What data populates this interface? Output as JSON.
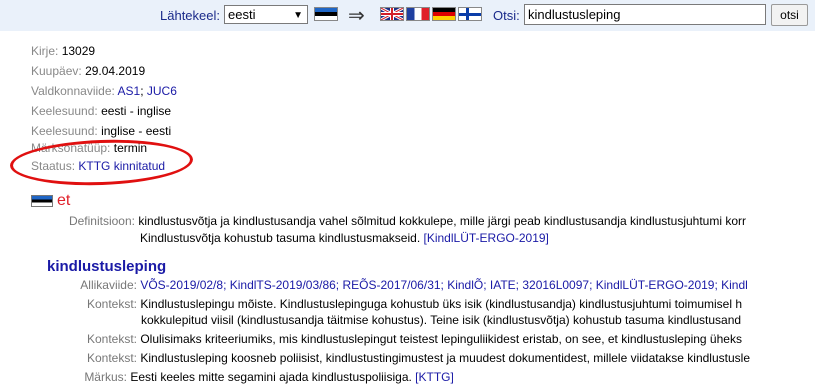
{
  "topbar": {
    "source_lang_label": "Lähtekeel:",
    "source_lang_value": "eesti",
    "arrow": "⇒",
    "search_label": "Otsi:",
    "search_value": "kindlustusleping",
    "search_button": "otsi"
  },
  "meta": {
    "kirje_label": "Kirje:",
    "kirje_value": "13029",
    "kuupaev_label": "Kuupäev:",
    "kuupaev_value": "29.04.2019",
    "valdkond_label": "Valdkonnaviide:",
    "valdkond_link1": "AS1",
    "valdkond_sep": ";",
    "valdkond_link2": "JUC6",
    "keelesuund1_label": "Keelesuund:",
    "keelesuund1_value": "eesti - inglise",
    "keelesuund2_label": "Keelesuund:",
    "keelesuund2_value": "inglise - eesti",
    "maaratlus_label": "Märksõnatüüp:",
    "maaratlus_value": "termin",
    "staatus_label": "Staatus:",
    "staatus_value": "KTTG kinnitatud"
  },
  "lang": {
    "code": "et",
    "flag_icon": "estonia-flag"
  },
  "definition": {
    "label": "Definitsioon:",
    "line1": "kindlustusvõtja ja kindlustusandja vahel sõlmitud kokkulepe, mille järgi peab kindlustusandja kindlustusjuhtumi korr",
    "line2": "Kindlustusvõtja kohustub tasuma kindlustusmakseid.",
    "source": "[KindlLÜT-ERGO-2019]"
  },
  "term": {
    "headword": "kindlustusleping",
    "allikaviide_label": "Allikaviide:",
    "allikaviide_links": "VÕS-2019/02/8; KindlTS-2019/03/86; REÕS-2017/06/31; KindlÕ; IATE; 32016L0097; KindlLÜT-ERGO-2019; Kindl",
    "contexts": [
      {
        "label": "Kontekst:",
        "line1": "Kindlustuslepingu mõiste. Kindlustuslepinguga kohustub üks isik (kindlustusandja) kindlustusjuhtumi toimumisel h",
        "line2": "kokkulepitud viisil (kindlustusandja täitmise kohustus). Teine isik (kindlustusvõtja) kohustub tasuma kindlustusand"
      },
      {
        "label": "Kontekst:",
        "line1": "Olulisimaks kriteeriumiks, mis kindlustuslepingut teistest lepinguliikidest eristab, on see, et kindlustusleping üheks"
      },
      {
        "label": "Kontekst:",
        "line1": "Kindlustusleping koosneb poliisist, kindlustustingimustest ja muudest dokumentidest, millele viidatakse kindlustusle"
      }
    ],
    "markus_label": "Märkus:",
    "markus_value": "Eesti keeles mitte segamini ajada kindlustuspoliisiga.",
    "markus_source": "[KTTG]"
  }
}
